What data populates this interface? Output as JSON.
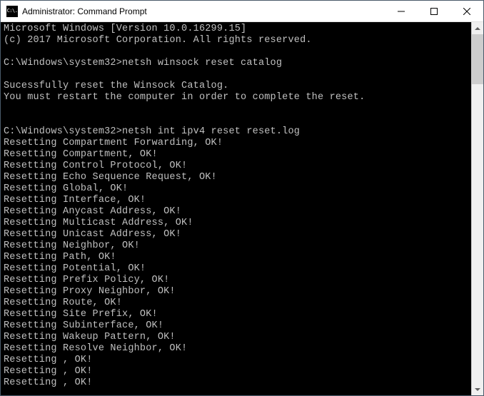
{
  "window": {
    "title": "Administrator: Command Prompt",
    "icon_text": "C:\\."
  },
  "terminal": {
    "lines": [
      "Microsoft Windows [Version 10.0.16299.15]",
      "(c) 2017 Microsoft Corporation. All rights reserved.",
      "",
      "C:\\Windows\\system32>netsh winsock reset catalog",
      "",
      "Sucessfully reset the Winsock Catalog.",
      "You must restart the computer in order to complete the reset.",
      "",
      "",
      "C:\\Windows\\system32>netsh int ipv4 reset reset.log",
      "Resetting Compartment Forwarding, OK!",
      "Resetting Compartment, OK!",
      "Resetting Control Protocol, OK!",
      "Resetting Echo Sequence Request, OK!",
      "Resetting Global, OK!",
      "Resetting Interface, OK!",
      "Resetting Anycast Address, OK!",
      "Resetting Multicast Address, OK!",
      "Resetting Unicast Address, OK!",
      "Resetting Neighbor, OK!",
      "Resetting Path, OK!",
      "Resetting Potential, OK!",
      "Resetting Prefix Policy, OK!",
      "Resetting Proxy Neighbor, OK!",
      "Resetting Route, OK!",
      "Resetting Site Prefix, OK!",
      "Resetting Subinterface, OK!",
      "Resetting Wakeup Pattern, OK!",
      "Resetting Resolve Neighbor, OK!",
      "Resetting , OK!",
      "Resetting , OK!",
      "Resetting , OK!"
    ]
  }
}
